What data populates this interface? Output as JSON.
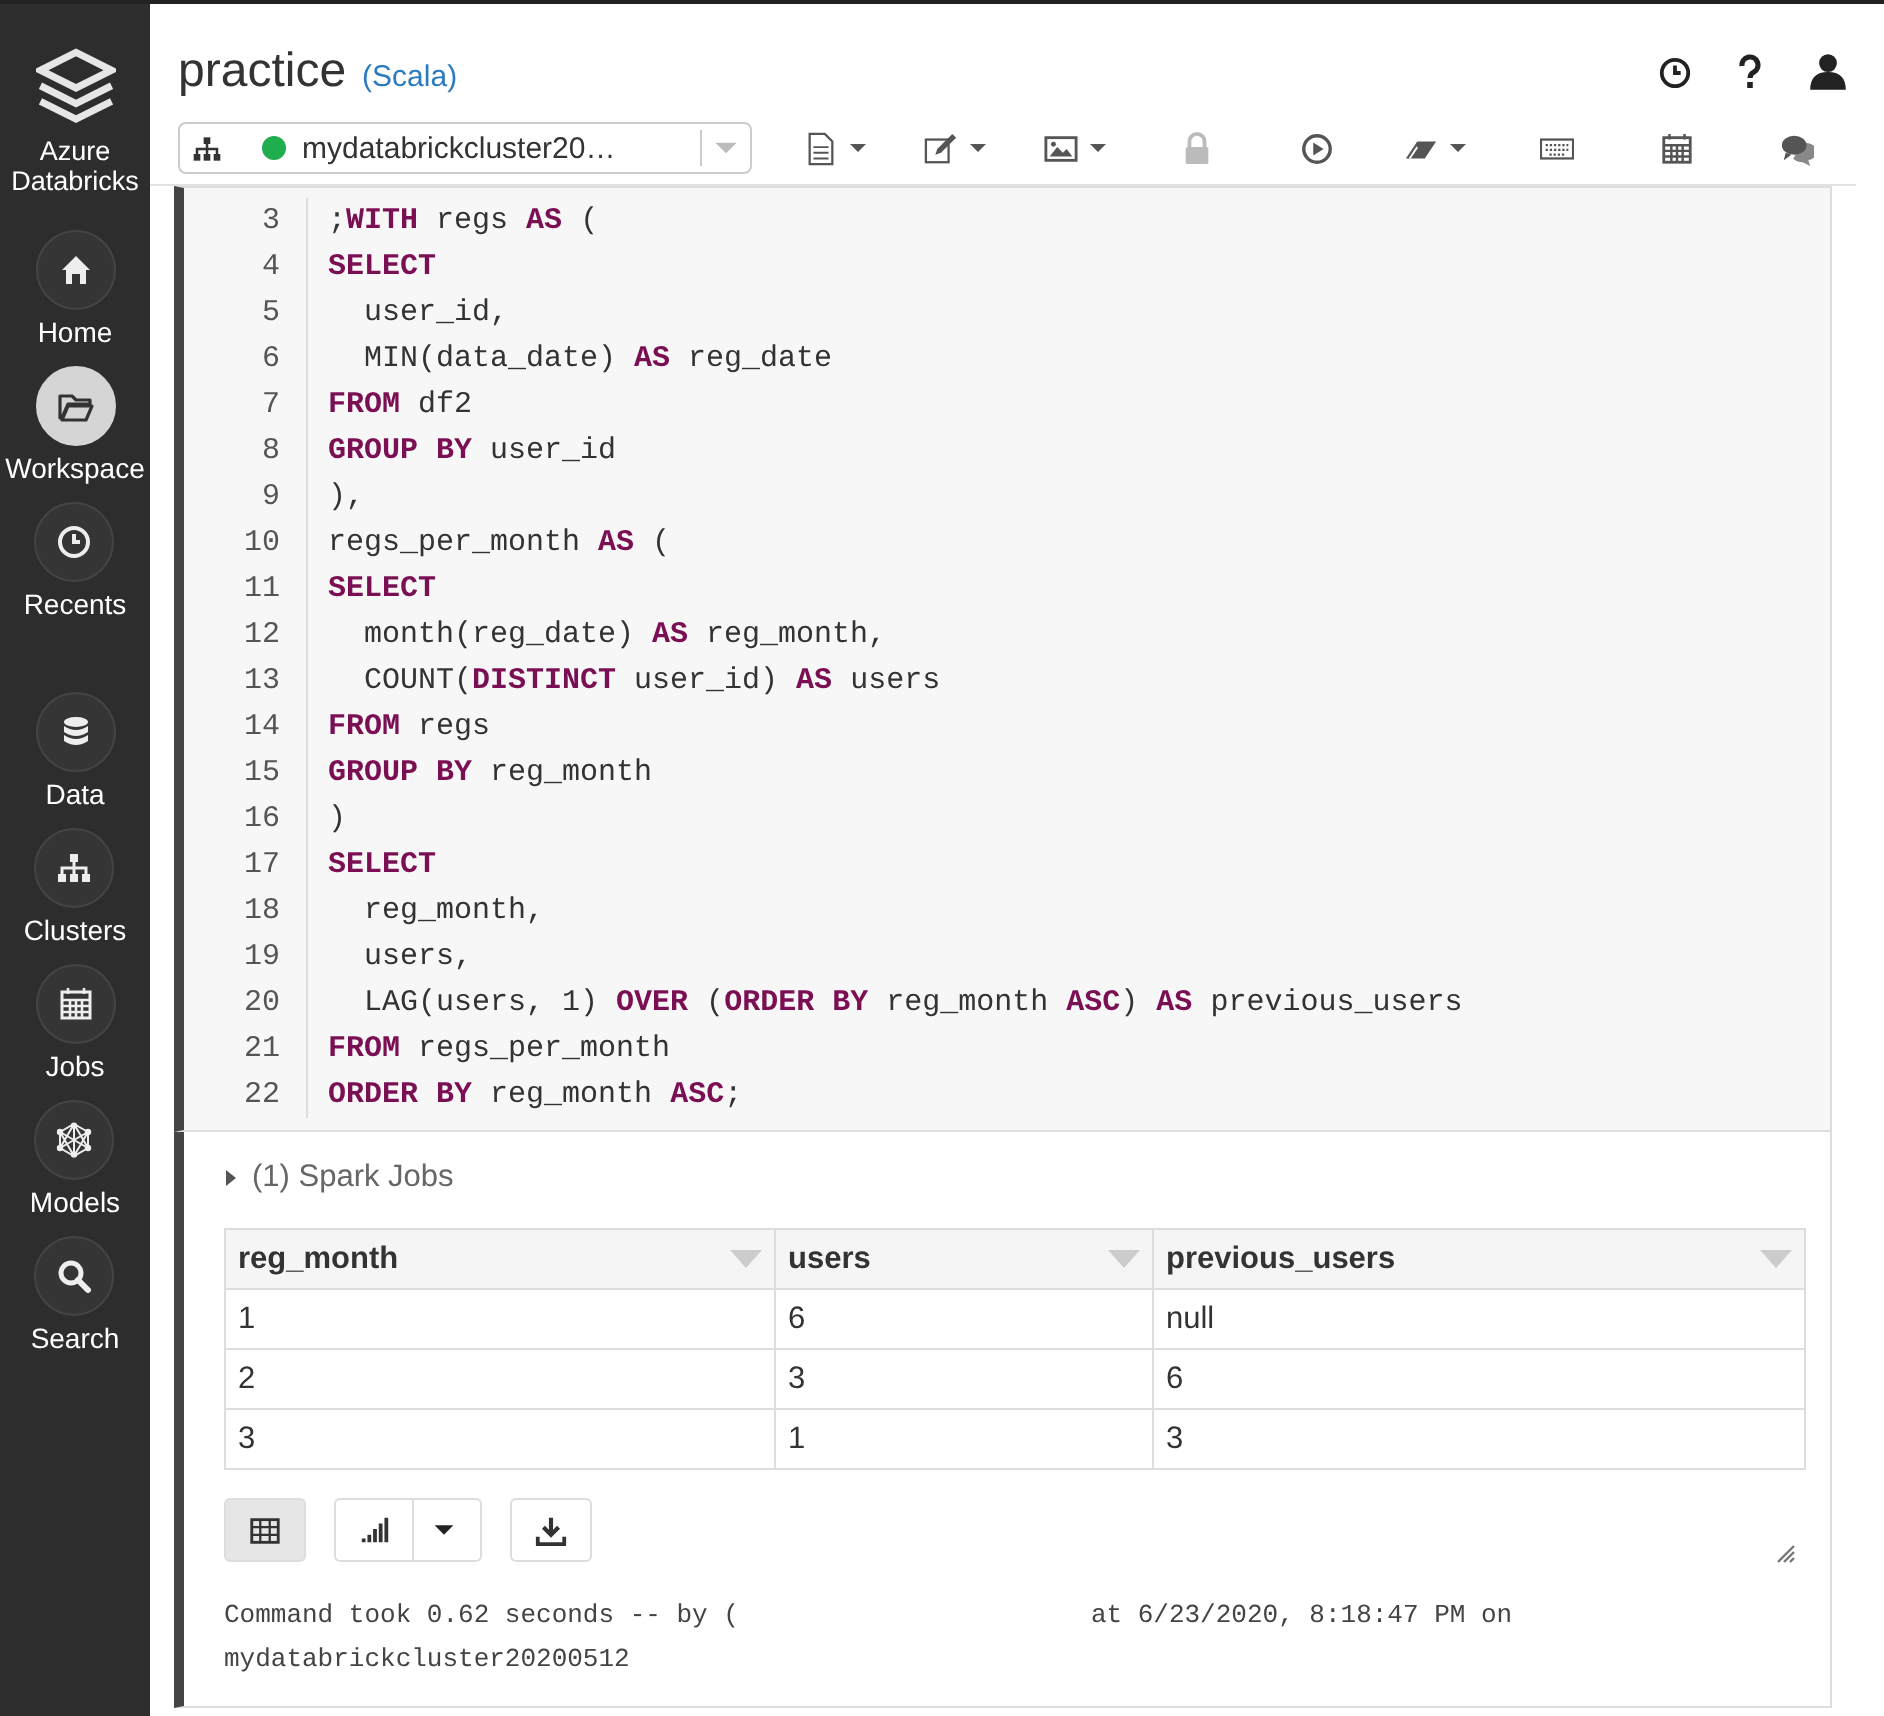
{
  "sidebar": {
    "brand": "Azure Databricks",
    "items": [
      {
        "label": "Home",
        "selected": false
      },
      {
        "label": "Workspace",
        "selected": true
      },
      {
        "label": "Recents",
        "selected": false
      },
      {
        "label": "Data",
        "selected": false
      },
      {
        "label": "Clusters",
        "selected": false
      },
      {
        "label": "Jobs",
        "selected": false
      },
      {
        "label": "Models",
        "selected": false
      },
      {
        "label": "Search",
        "selected": false
      }
    ]
  },
  "notebook": {
    "title": "practice",
    "language": "(Scala)"
  },
  "cluster": {
    "name": "mydatabrickcluster20…",
    "running": true
  },
  "toolbar": [
    {
      "menu": true,
      "disabled": false
    },
    {
      "menu": true,
      "disabled": false
    },
    {
      "menu": true,
      "disabled": false
    },
    {
      "menu": false,
      "disabled": true
    },
    {
      "menu": false,
      "disabled": false
    },
    {
      "menu": true,
      "disabled": false
    },
    {
      "menu": false,
      "disabled": false
    },
    {
      "menu": false,
      "disabled": false
    },
    {
      "menu": false,
      "disabled": false
    }
  ],
  "code": [
    {
      "number": "3",
      "text": ";**WITH** regs **AS** ("
    },
    {
      "number": "4",
      "text": "**SELECT**"
    },
    {
      "number": "5",
      "text": "  user_id,"
    },
    {
      "number": "6",
      "text": "  MIN(data_date) **AS** reg_date"
    },
    {
      "number": "7",
      "text": "**FROM** df2"
    },
    {
      "number": "8",
      "text": "**GROUP** **BY** user_id"
    },
    {
      "number": "9",
      "text": "),"
    },
    {
      "number": "10",
      "text": "regs_per_month **AS** ("
    },
    {
      "number": "11",
      "text": "**SELECT**"
    },
    {
      "number": "12",
      "text": "  month(reg_date) **AS** reg_month,"
    },
    {
      "number": "13",
      "text": "  COUNT(**DISTINCT** user_id) **AS** users"
    },
    {
      "number": "14",
      "text": "**FROM** regs"
    },
    {
      "number": "15",
      "text": "**GROUP** **BY** reg_month"
    },
    {
      "number": "16",
      "text": ")"
    },
    {
      "number": "17",
      "text": "**SELECT**"
    },
    {
      "number": "18",
      "text": "  reg_month,"
    },
    {
      "number": "19",
      "text": "  users,"
    },
    {
      "number": "20",
      "text": "  LAG(users, 1) **OVER** (**ORDER** **BY** reg_month **ASC**) **AS** previous_users"
    },
    {
      "number": "21",
      "text": "**FROM** regs_per_month"
    },
    {
      "number": "22",
      "text": "**ORDER** **BY** reg_month **ASC**;"
    }
  ],
  "spark_jobs": {
    "label": "(1) Spark Jobs",
    "expanded": false
  },
  "table": {
    "columns": [
      "reg_month",
      "users",
      "previous_users"
    ],
    "rows": [
      [
        "1",
        "6",
        "null"
      ],
      [
        "2",
        "3",
        "6"
      ],
      [
        "3",
        "1",
        "3"
      ]
    ]
  },
  "result_buttons": [
    {
      "selected": true,
      "menu": false
    },
    {
      "selected": false,
      "menu": true
    },
    {
      "selected": false,
      "menu": false
    }
  ],
  "status": {
    "before": "Command took 0.62 seconds -- by (",
    "after": "at 6/23/2020, 8:18:47 PM on",
    "cluster": "mydatabrickcluster20200512"
  }
}
